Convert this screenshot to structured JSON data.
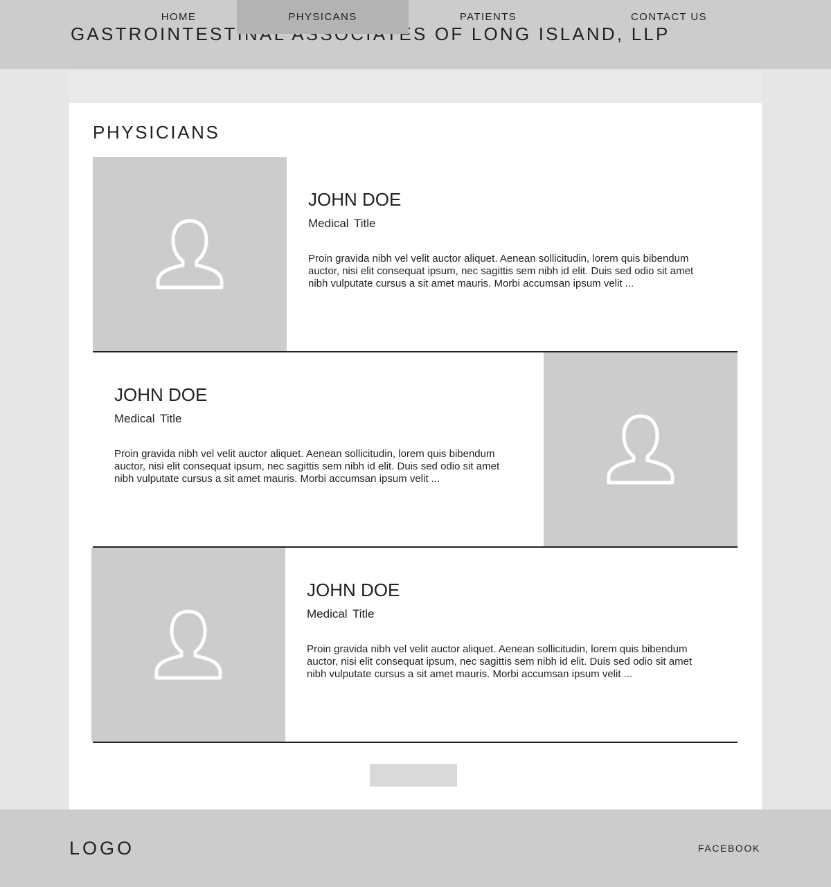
{
  "header": {
    "site_title": "GASTROINTESTINAL ASSOCIATES OF LONG ISLAND, LLP"
  },
  "nav": {
    "items": [
      {
        "label": "HOME",
        "active": false
      },
      {
        "label": "PHYSICANS",
        "active": true
      },
      {
        "label": "PATIENTS",
        "active": false
      },
      {
        "label": "CONTACT US",
        "active": false
      }
    ]
  },
  "main": {
    "heading": "PHYSICIANS",
    "physicians": [
      {
        "name": "JOHN DOE",
        "title": "Medical Title",
        "bio": "Proin gravida nibh vel velit auctor aliquet. Aenean sollicitudin, lorem quis bibendum auctor, nisi elit consequat ipsum, nec sagittis sem nibh id elit. Duis sed odio sit amet nibh vulputate cursus a sit amet mauris. Morbi accumsan ipsum velit ...",
        "photo_icon": "user-icon"
      },
      {
        "name": "JOHN DOE",
        "title": "Medical Title",
        "bio": "Proin gravida nibh vel velit auctor aliquet. Aenean sollicitudin, lorem quis bibendum auctor, nisi elit consequat ipsum, nec sagittis sem nibh id elit. Duis sed odio sit amet nibh vulputate cursus a sit amet mauris. Morbi accumsan ipsum velit ...",
        "photo_icon": "user-icon"
      },
      {
        "name": "JOHN DOE",
        "title": "Medical Title",
        "bio": "Proin gravida nibh vel velit auctor aliquet. Aenean sollicitudin, lorem quis bibendum auctor, nisi elit consequat ipsum, nec sagittis sem nibh id elit. Duis sed odio sit amet nibh vulputate cursus a sit amet mauris. Morbi accumsan ipsum velit ...",
        "photo_icon": "user-icon"
      }
    ]
  },
  "footer": {
    "logo": "LOGO",
    "social_link": "FACEBOOK"
  },
  "colors": {
    "header_bg": "#cccccc",
    "page_bg": "#e6e6e6",
    "nav_bg": "#e9e9e9",
    "nav_active_bg": "#b3b3b3",
    "photo_placeholder": "#cccccc",
    "text": "#231f20"
  }
}
